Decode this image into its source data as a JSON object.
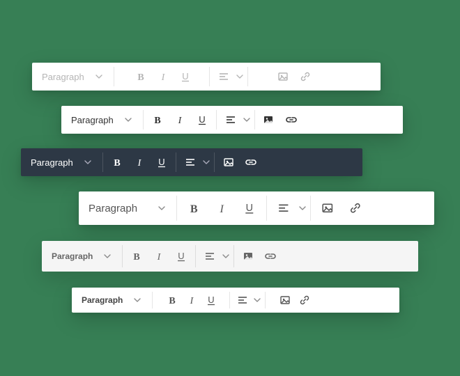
{
  "toolbars": [
    {
      "id": "t1",
      "select_label": "Paragraph"
    },
    {
      "id": "t2",
      "select_label": "Paragraph"
    },
    {
      "id": "t3",
      "select_label": "Paragraph"
    },
    {
      "id": "t4",
      "select_label": "Paragraph"
    },
    {
      "id": "t5",
      "select_label": "Paragraph"
    },
    {
      "id": "t6",
      "select_label": "Paragraph"
    }
  ],
  "icons": {
    "bold": "B",
    "italic": "I",
    "underline": "U",
    "align": "align",
    "image": "image",
    "link": "link"
  }
}
